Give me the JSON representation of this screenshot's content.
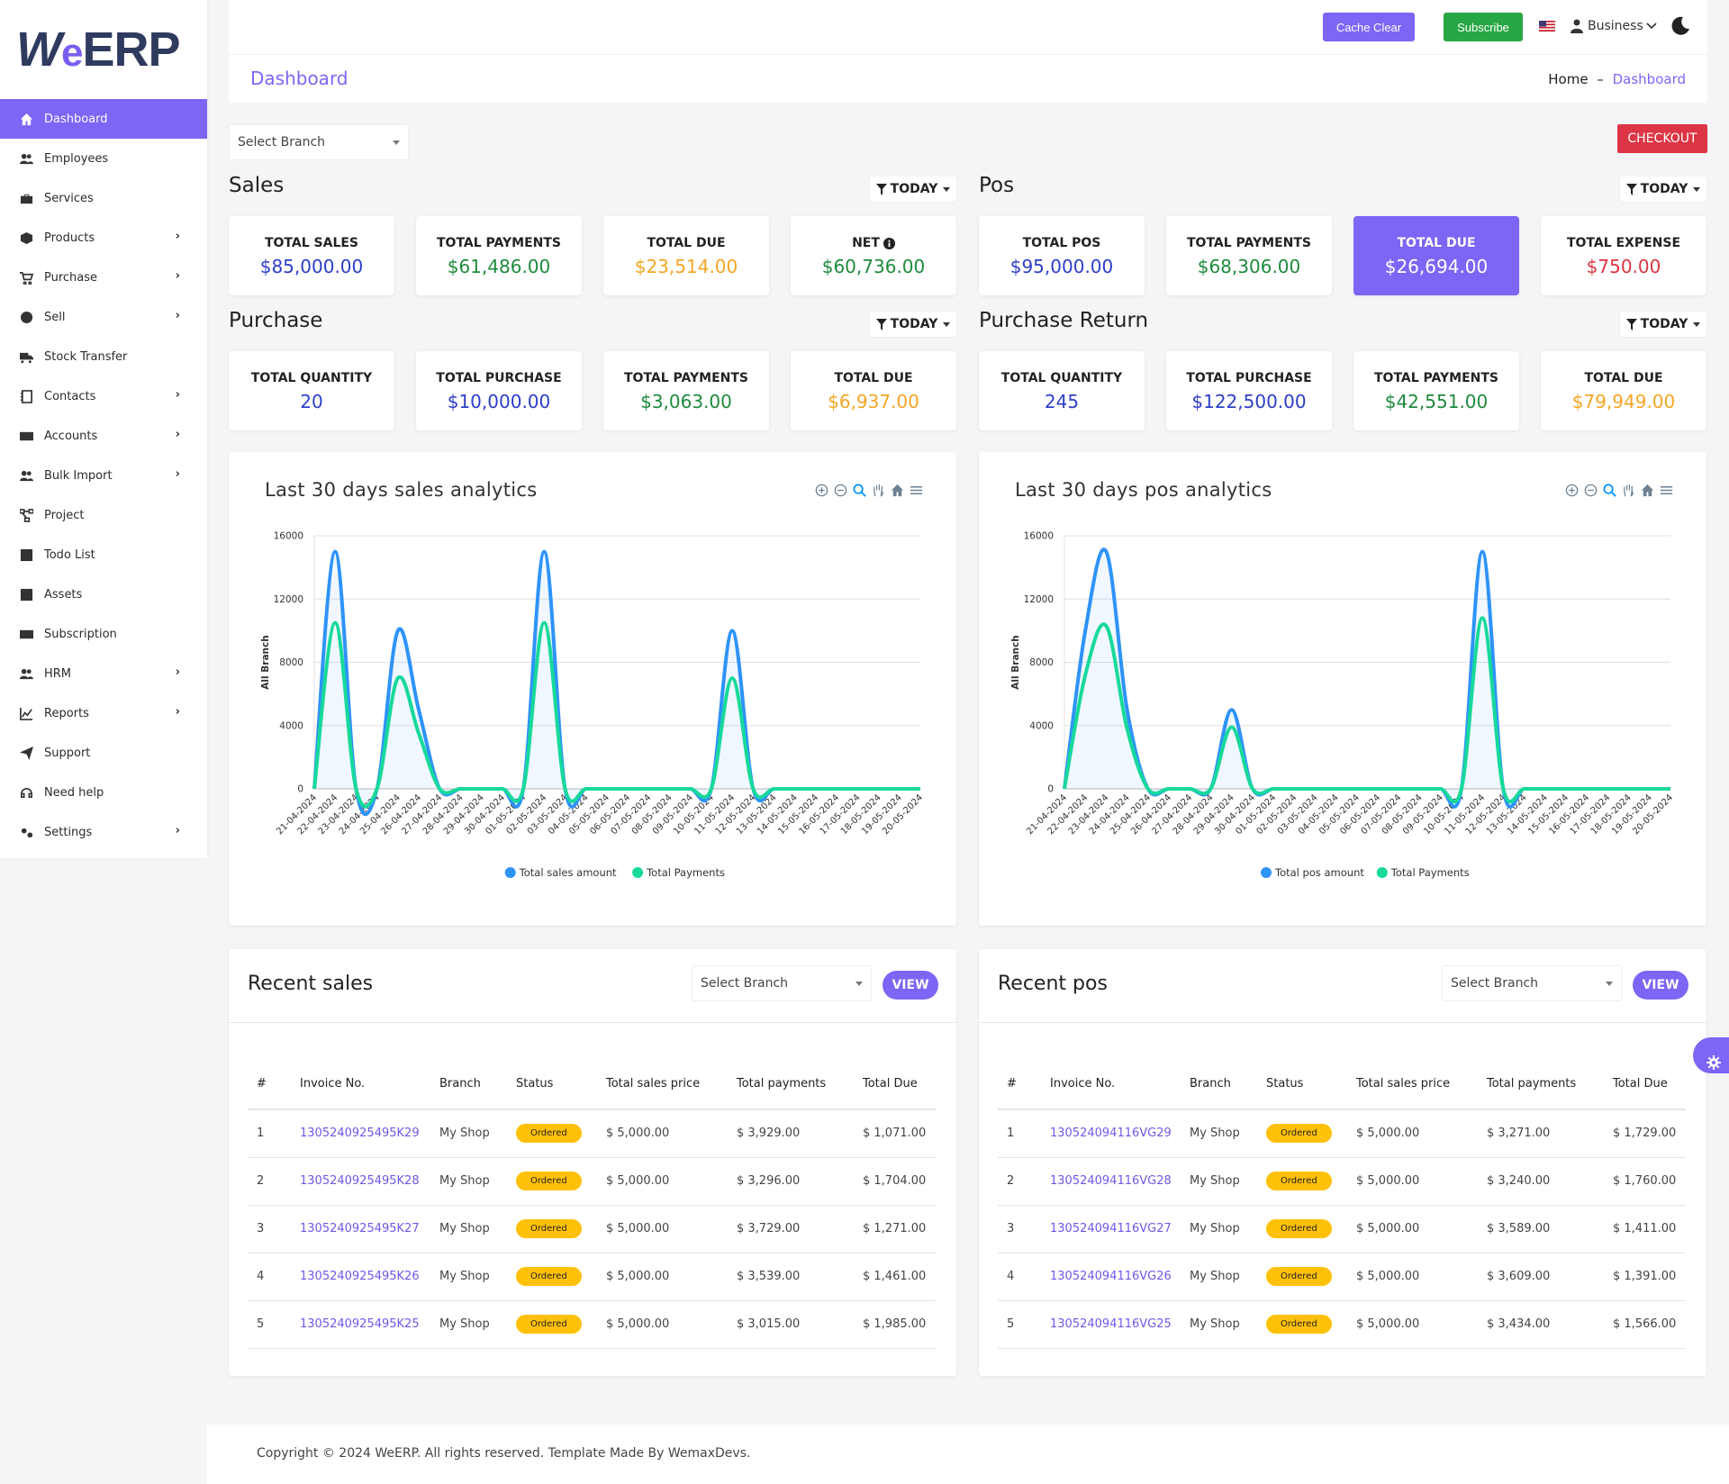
{
  "sidebar": {
    "logo": {
      "part1": "W",
      "part2": "e",
      "part3": "ERP"
    },
    "items": [
      {
        "label": "Dashboard",
        "icon": "home-icon",
        "active": true,
        "has_children": false
      },
      {
        "label": "Employees",
        "icon": "users-icon",
        "has_children": false
      },
      {
        "label": "Services",
        "icon": "briefcase-icon",
        "has_children": false
      },
      {
        "label": "Products",
        "icon": "box-icon",
        "has_children": true
      },
      {
        "label": "Purchase",
        "icon": "cart-icon",
        "has_children": true
      },
      {
        "label": "Sell",
        "icon": "dollar-circle-icon",
        "has_children": true
      },
      {
        "label": "Stock Transfer",
        "icon": "truck-icon",
        "has_children": false
      },
      {
        "label": "Contacts",
        "icon": "address-book-icon",
        "has_children": true
      },
      {
        "label": "Accounts",
        "icon": "wallet-icon",
        "has_children": true
      },
      {
        "label": "Bulk Import",
        "icon": "users-icon",
        "has_children": true
      },
      {
        "label": "Project",
        "icon": "project-diagram-icon",
        "has_children": false
      },
      {
        "label": "Todo List",
        "icon": "list-icon",
        "has_children": false
      },
      {
        "label": "Assets",
        "icon": "list-icon",
        "has_children": false
      },
      {
        "label": "Subscription",
        "icon": "money-bill-icon",
        "has_children": false
      },
      {
        "label": "HRM",
        "icon": "users-icon",
        "has_children": true
      },
      {
        "label": "Reports",
        "icon": "chart-icon",
        "has_children": true
      },
      {
        "label": "Support",
        "icon": "paper-plane-icon",
        "has_children": false
      },
      {
        "label": "Need help",
        "icon": "headset-icon",
        "has_children": false
      },
      {
        "label": "Settings",
        "icon": "gears-icon",
        "has_children": true
      }
    ]
  },
  "topbar": {
    "cache_clear": "Cache Clear",
    "subscribe": "Subscribe",
    "business": "Business",
    "flag_icon": "us-flag-icon",
    "theme_icon": "moon-icon"
  },
  "header": {
    "title": "Dashboard",
    "breadcrumb_home": "Home",
    "breadcrumb_sep": "–",
    "breadcrumb_current": "Dashboard"
  },
  "branch_select": {
    "placeholder": "Select Branch"
  },
  "checkout": "CHECKOUT",
  "sections": {
    "sales": {
      "title": "Sales",
      "filter": "TODAY",
      "cards": [
        {
          "label": "TOTAL SALES",
          "value": "$85,000.00",
          "color": "#2d3ec9"
        },
        {
          "label": "TOTAL PAYMENTS",
          "value": "$61,486.00",
          "color": "#1e8a3d"
        },
        {
          "label": "TOTAL DUE",
          "value": "$23,514.00",
          "color": "#f4a623"
        },
        {
          "label": "NET",
          "value": "$60,736.00",
          "color": "#1e8a3d",
          "info_icon": true
        }
      ]
    },
    "pos": {
      "title": "Pos",
      "filter": "TODAY",
      "cards": [
        {
          "label": "TOTAL POS",
          "value": "$95,000.00",
          "color": "#2d3ec9"
        },
        {
          "label": "TOTAL PAYMENTS",
          "value": "$68,306.00",
          "color": "#1e8a3d"
        },
        {
          "label": "TOTAL DUE",
          "value": "$26,694.00",
          "color": "#ffffff",
          "highlight": true
        },
        {
          "label": "TOTAL EXPENSE",
          "value": "$750.00",
          "color": "#dc3545"
        }
      ]
    },
    "purchase": {
      "title": "Purchase",
      "filter": "TODAY",
      "cards": [
        {
          "label": "TOTAL QUANTITY",
          "value": "20",
          "color": "#2d3ec9"
        },
        {
          "label": "TOTAL PURCHASE",
          "value": "$10,000.00",
          "color": "#2d3ec9"
        },
        {
          "label": "TOTAL PAYMENTS",
          "value": "$3,063.00",
          "color": "#1e8a3d"
        },
        {
          "label": "TOTAL DUE",
          "value": "$6,937.00",
          "color": "#f4a623"
        }
      ]
    },
    "purchase_return": {
      "title": "Purchase Return",
      "filter": "TODAY",
      "cards": [
        {
          "label": "TOTAL QUANTITY",
          "value": "245",
          "color": "#2d3ec9"
        },
        {
          "label": "TOTAL PURCHASE",
          "value": "$122,500.00",
          "color": "#2d3ec9"
        },
        {
          "label": "TOTAL PAYMENTS",
          "value": "$42,551.00",
          "color": "#1e8a3d"
        },
        {
          "label": "TOTAL DUE",
          "value": "$79,949.00",
          "color": "#f4a623"
        }
      ]
    }
  },
  "chart_data": [
    {
      "type": "area",
      "title": "Last 30 days sales analytics",
      "ylabel": "All Branch",
      "ylim": [
        0,
        16000
      ],
      "yticks": [
        0,
        4000,
        8000,
        12000,
        16000
      ],
      "x": [
        "21-04-2024",
        "22-04-2024",
        "23-04-2024",
        "24-04-2024",
        "25-04-2024",
        "26-04-2024",
        "27-04-2024",
        "28-04-2024",
        "29-04-2024",
        "30-04-2024",
        "01-05-2024",
        "02-05-2024",
        "03-05-2024",
        "04-05-2024",
        "05-05-2024",
        "06-05-2024",
        "07-05-2024",
        "08-05-2024",
        "09-05-2024",
        "10-05-2024",
        "11-05-2024",
        "12-05-2024",
        "13-05-2024",
        "14-05-2024",
        "15-05-2024",
        "16-05-2024",
        "17-05-2024",
        "18-05-2024",
        "19-05-2024",
        "20-05-2024"
      ],
      "series": [
        {
          "name": "Total sales amount",
          "color": "#2e93fa",
          "values": [
            0,
            15000,
            0,
            0,
            10000,
            5000,
            0,
            0,
            0,
            0,
            0,
            15000,
            0,
            0,
            0,
            0,
            0,
            0,
            0,
            0,
            10000,
            0,
            0,
            0,
            0,
            0,
            0,
            0,
            0,
            0
          ]
        },
        {
          "name": "Total Payments",
          "color": "#18d99a",
          "values": [
            0,
            10500,
            0,
            0,
            7000,
            3500,
            0,
            0,
            0,
            0,
            0,
            10500,
            0,
            0,
            0,
            0,
            0,
            0,
            0,
            0,
            7000,
            0,
            0,
            0,
            0,
            0,
            0,
            0,
            0,
            0
          ]
        }
      ],
      "legend": "bottom-center"
    },
    {
      "type": "area",
      "title": "Last 30 days pos analytics",
      "ylabel": "All Branch",
      "ylim": [
        0,
        16000
      ],
      "yticks": [
        0,
        4000,
        8000,
        12000,
        16000
      ],
      "x": [
        "21-04-2024",
        "22-04-2024",
        "23-04-2024",
        "24-04-2024",
        "25-04-2024",
        "26-04-2024",
        "27-04-2024",
        "28-04-2024",
        "29-04-2024",
        "30-04-2024",
        "01-05-2024",
        "02-05-2024",
        "03-05-2024",
        "04-05-2024",
        "05-05-2024",
        "06-05-2024",
        "07-05-2024",
        "08-05-2024",
        "09-05-2024",
        "10-05-2024",
        "11-05-2024",
        "12-05-2024",
        "13-05-2024",
        "14-05-2024",
        "15-05-2024",
        "16-05-2024",
        "17-05-2024",
        "18-05-2024",
        "19-05-2024",
        "20-05-2024"
      ],
      "series": [
        {
          "name": "Total pos amount",
          "color": "#2e93fa",
          "values": [
            0,
            10000,
            15000,
            5000,
            0,
            0,
            0,
            0,
            5000,
            0,
            0,
            0,
            0,
            0,
            0,
            0,
            0,
            0,
            0,
            0,
            15000,
            0,
            0,
            0,
            0,
            0,
            0,
            0,
            0,
            0
          ]
        },
        {
          "name": "Total Payments",
          "color": "#18d99a",
          "values": [
            0,
            7200,
            10300,
            3800,
            0,
            0,
            0,
            0,
            3900,
            0,
            0,
            0,
            0,
            0,
            0,
            0,
            0,
            0,
            0,
            0,
            10800,
            0,
            0,
            0,
            0,
            0,
            0,
            0,
            0,
            0
          ]
        }
      ],
      "legend": "bottom-center"
    }
  ],
  "recent_sales": {
    "title": "Recent sales",
    "select_placeholder": "Select Branch",
    "view": "VIEW",
    "columns": [
      "#",
      "Invoice No.",
      "Branch",
      "Status",
      "Total sales price",
      "Total payments",
      "Total Due"
    ],
    "rows": [
      [
        "1",
        "1305240925495K29",
        "My Shop",
        "Ordered",
        "$ 5,000.00",
        "$ 3,929.00",
        "$ 1,071.00"
      ],
      [
        "2",
        "1305240925495K28",
        "My Shop",
        "Ordered",
        "$ 5,000.00",
        "$ 3,296.00",
        "$ 1,704.00"
      ],
      [
        "3",
        "1305240925495K27",
        "My Shop",
        "Ordered",
        "$ 5,000.00",
        "$ 3,729.00",
        "$ 1,271.00"
      ],
      [
        "4",
        "1305240925495K26",
        "My Shop",
        "Ordered",
        "$ 5,000.00",
        "$ 3,539.00",
        "$ 1,461.00"
      ],
      [
        "5",
        "1305240925495K25",
        "My Shop",
        "Ordered",
        "$ 5,000.00",
        "$ 3,015.00",
        "$ 1,985.00"
      ]
    ]
  },
  "recent_pos": {
    "title": "Recent pos",
    "select_placeholder": "Select Branch",
    "view": "VIEW",
    "columns": [
      "#",
      "Invoice No.",
      "Branch",
      "Status",
      "Total sales price",
      "Total payments",
      "Total Due"
    ],
    "rows": [
      [
        "1",
        "130524094116VG29",
        "My Shop",
        "Ordered",
        "$ 5,000.00",
        "$ 3,271.00",
        "$ 1,729.00"
      ],
      [
        "2",
        "130524094116VG28",
        "My Shop",
        "Ordered",
        "$ 5,000.00",
        "$ 3,240.00",
        "$ 1,760.00"
      ],
      [
        "3",
        "130524094116VG27",
        "My Shop",
        "Ordered",
        "$ 5,000.00",
        "$ 3,589.00",
        "$ 1,411.00"
      ],
      [
        "4",
        "130524094116VG26",
        "My Shop",
        "Ordered",
        "$ 5,000.00",
        "$ 3,609.00",
        "$ 1,391.00"
      ],
      [
        "5",
        "130524094116VG25",
        "My Shop",
        "Ordered",
        "$ 5,000.00",
        "$ 3,434.00",
        "$ 1,566.00"
      ]
    ]
  },
  "footer": {
    "copyright": "Copyright © 2024 WeERP. All rights reserved. Template Made By WemaxDevs."
  }
}
